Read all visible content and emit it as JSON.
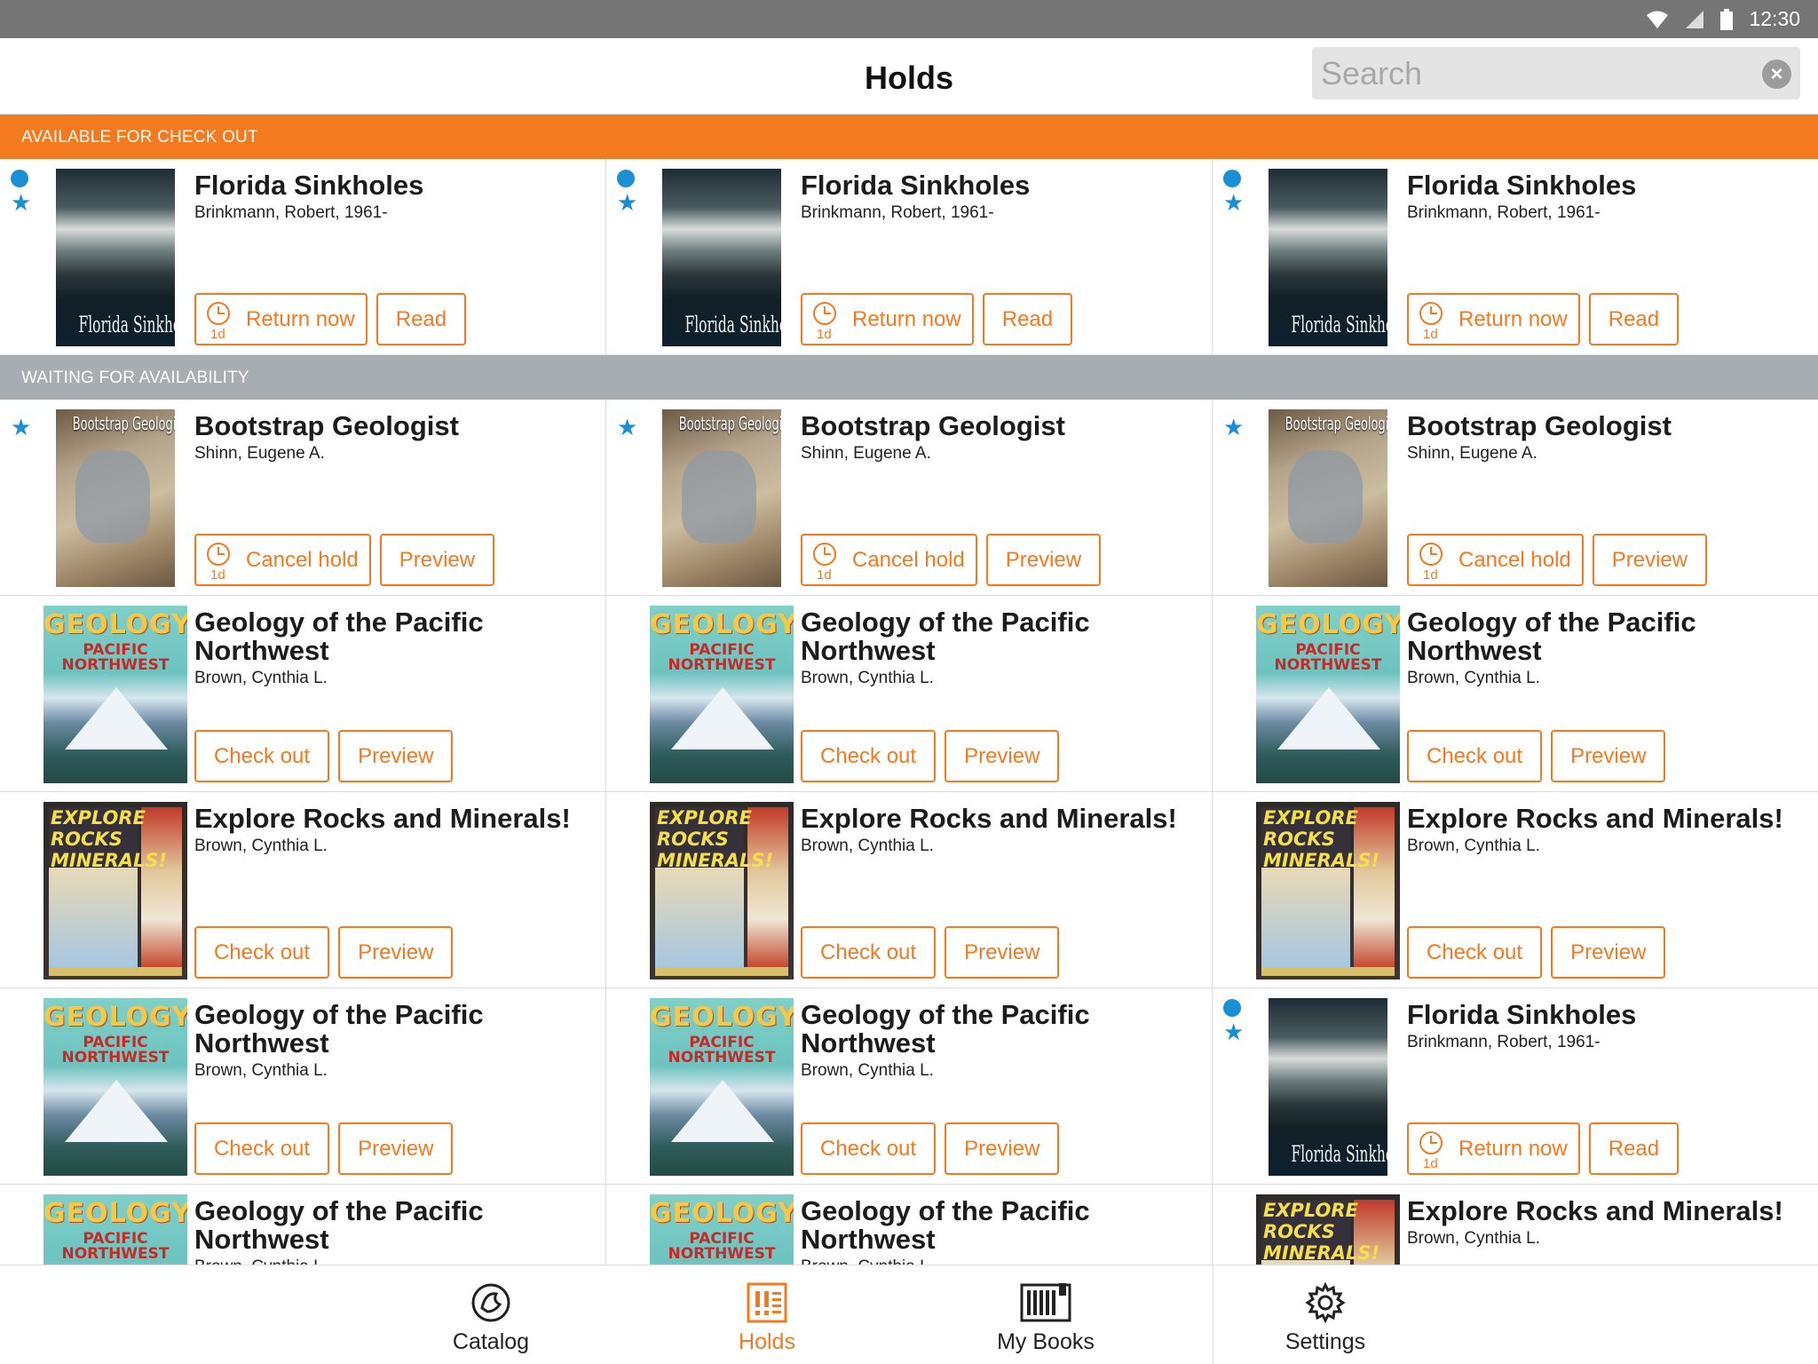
{
  "status_bar": {
    "time": "12:30"
  },
  "header": {
    "title": "Holds",
    "search_placeholder": "Search"
  },
  "sections": {
    "available": "AVAILABLE FOR CHECK OUT",
    "waiting": "WAITING FOR AVAILABILITY"
  },
  "available_items": [
    {
      "title": "Florida Sinkholes",
      "author": "Brinkmann, Robert, 1961-",
      "cover_text": "Florida Sinkholes",
      "primary": "Return now",
      "secondary": "Read",
      "duration": "1d"
    },
    {
      "title": "Florida Sinkholes",
      "author": "Brinkmann, Robert, 1961-",
      "cover_text": "Florida Sinkholes",
      "primary": "Return now",
      "secondary": "Read",
      "duration": "1d"
    },
    {
      "title": "Florida Sinkholes",
      "author": "Brinkmann, Robert, 1961-",
      "cover_text": "Florida Sinkholes",
      "primary": "Return now",
      "secondary": "Read",
      "duration": "1d"
    }
  ],
  "waiting_items": [
    {
      "title": "Bootstrap Geologist",
      "author": "Shinn, Eugene A.",
      "cover_text": "Bootstrap Geologist",
      "primary": "Cancel hold",
      "secondary": "Preview",
      "duration": "1d"
    },
    {
      "title": "Bootstrap Geologist",
      "author": "Shinn, Eugene A.",
      "cover_text": "Bootstrap Geologist",
      "primary": "Cancel hold",
      "secondary": "Preview",
      "duration": "1d"
    },
    {
      "title": "Bootstrap Geologist",
      "author": "Shinn, Eugene A.",
      "cover_text": "Bootstrap Geologist",
      "primary": "Cancel hold",
      "secondary": "Preview",
      "duration": "1d"
    },
    {
      "title": "Geology of the Pacific Northwest",
      "author": "Brown, Cynthia L.",
      "cover_text_1": "GEOLOGY",
      "cover_text_2": "PACIFIC NORTHWEST",
      "primary": "Check out",
      "secondary": "Preview"
    },
    {
      "title": "Geology of the Pacific Northwest",
      "author": "Brown, Cynthia L.",
      "cover_text_1": "GEOLOGY",
      "cover_text_2": "PACIFIC NORTHWEST",
      "primary": "Check out",
      "secondary": "Preview"
    },
    {
      "title": "Geology of the Pacific Northwest",
      "author": "Brown, Cynthia L.",
      "cover_text_1": "GEOLOGY",
      "cover_text_2": "PACIFIC NORTHWEST",
      "primary": "Check out",
      "secondary": "Preview"
    },
    {
      "title": "Explore Rocks and Minerals!",
      "author": "Brown, Cynthia L.",
      "cover_text": "EXPLORE ROCKS MINERALS!",
      "primary": "Check out",
      "secondary": "Preview"
    },
    {
      "title": "Explore Rocks and Minerals!",
      "author": "Brown, Cynthia L.",
      "cover_text": "EXPLORE ROCKS MINERALS!",
      "primary": "Check out",
      "secondary": "Preview"
    },
    {
      "title": "Explore Rocks and Minerals!",
      "author": "Brown, Cynthia L.",
      "cover_text": "EXPLORE ROCKS MINERALS!",
      "primary": "Check out",
      "secondary": "Preview"
    },
    {
      "title": "Geology of the Pacific Northwest",
      "author": "Brown, Cynthia L.",
      "cover_text_1": "GEOLOGY",
      "cover_text_2": "PACIFIC NORTHWEST",
      "primary": "Check out",
      "secondary": "Preview"
    },
    {
      "title": "Geology of the Pacific Northwest",
      "author": "Brown, Cynthia L.",
      "cover_text_1": "GEOLOGY",
      "cover_text_2": "PACIFIC NORTHWEST",
      "primary": "Check out",
      "secondary": "Preview"
    },
    {
      "title": "Florida Sinkholes",
      "author": "Brinkmann, Robert, 1961-",
      "cover_text": "Florida Sinkholes",
      "primary": "Return now",
      "secondary": "Read",
      "duration": "1d"
    },
    {
      "title": "Geology of the Pacific Northwest",
      "author": "Brown, Cynthia L.",
      "cover_text_1": "GEOLOGY",
      "cover_text_2": "PACIFIC NORTHWEST"
    },
    {
      "title": "Geology of the Pacific Northwest",
      "author": "Brown, Cynthia L.",
      "cover_text_1": "GEOLOGY",
      "cover_text_2": "PACIFIC NORTHWEST"
    },
    {
      "title": "Explore Rocks and Minerals!",
      "author": "Brown, Cynthia L.",
      "cover_text": "EXPLORE ROCKS MINERALS!"
    }
  ],
  "tabs": [
    {
      "label": "Catalog",
      "icon": "catalog-icon"
    },
    {
      "label": "Holds",
      "icon": "holds-icon",
      "active": true
    },
    {
      "label": "My Books",
      "icon": "my-books-icon"
    },
    {
      "label": "Settings",
      "icon": "settings-icon"
    }
  ],
  "colors": {
    "accent": "#f47a20",
    "indicator": "#1a8fd6",
    "waiting_header": "#a8adb2",
    "status_bar": "#757575"
  }
}
